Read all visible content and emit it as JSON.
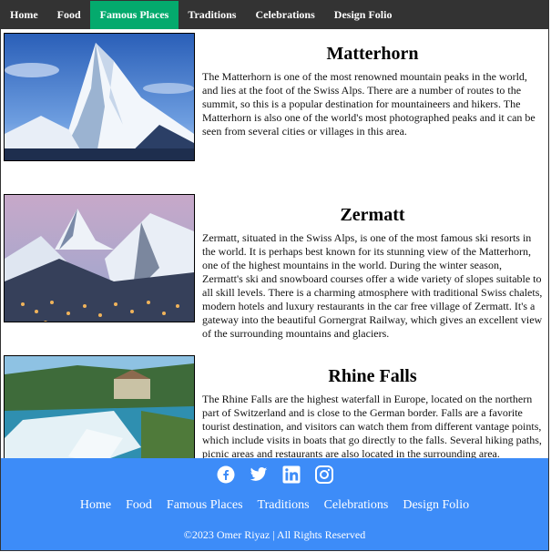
{
  "nav": {
    "items": [
      {
        "label": "Home"
      },
      {
        "label": "Food"
      },
      {
        "label": "Famous Places"
      },
      {
        "label": "Traditions"
      },
      {
        "label": "Celebrations"
      },
      {
        "label": "Design Folio"
      }
    ],
    "active_index": 2,
    "active_color": "#04AA6D",
    "bar_color": "#333333"
  },
  "places": [
    {
      "title": "Matterhorn",
      "image": "matterhorn-mountain-photo",
      "text": "The Matterhorn is one of the most renowned mountain peaks in the world, and lies at the foot of the Swiss Alps. There are a number of routes to the summit, so this is a popular destination for mountaineers and hikers. The Matterhorn is also one of the world's most photographed peaks and it can be seen from several cities or villages in this area."
    },
    {
      "title": "Zermatt",
      "image": "zermatt-village-photo",
      "text": "Zermatt, situated in the Swiss Alps, is one of the most famous ski resorts in the world. It is perhaps best known for its stunning view of the Matterhorn, one of the highest mountains in the world. During the winter season, Zermatt's ski and snowboard courses offer a wide variety of slopes suitable to all skill levels. There is a charming atmosphere with traditional Swiss chalets, modern hotels and luxury restaurants in the car free village of Zermatt. It's a gateway into the beautiful Gornergrat Railway, which gives an excellent view of the surrounding mountains and glaciers."
    },
    {
      "title": "Rhine Falls",
      "image": "rhine-falls-photo",
      "text": "The Rhine Falls are the highest waterfall in Europe, located on the northern part of Switzerland and is close to the German border. Falls are a favorite tourist destination, and visitors can watch them from different vantage points, which include visits in boats that go directly to the falls. Several hiking paths, picnic areas and restaurants are also located in the surrounding area."
    }
  ],
  "footer": {
    "background": "#3d8cf8",
    "social": [
      "facebook-icon",
      "twitter-icon",
      "linkedin-icon",
      "instagram-icon"
    ],
    "links": [
      {
        "label": "Home"
      },
      {
        "label": "Food"
      },
      {
        "label": "Famous Places"
      },
      {
        "label": "Traditions"
      },
      {
        "label": "Celebrations"
      },
      {
        "label": "Design Folio"
      }
    ],
    "copyright": "©2023 Omer Riyaz | All Rights Reserved"
  }
}
